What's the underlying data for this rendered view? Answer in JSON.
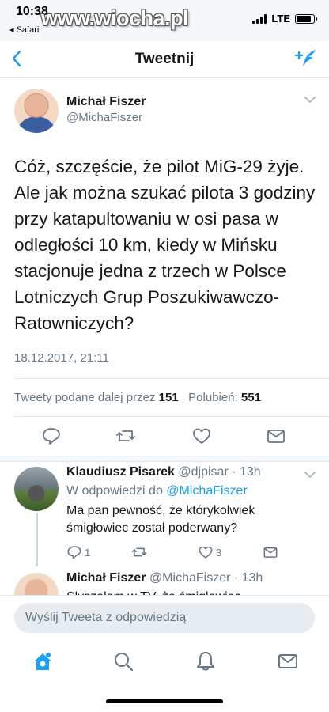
{
  "status_bar": {
    "time": "10:38",
    "back_app": "◂ Safari",
    "network": "LTE",
    "battery_level": 0.85,
    "watermark": "www.wiocha.pl"
  },
  "header": {
    "title": "Tweetnij",
    "back_icon": "chevron-left-icon",
    "compose_icon": "compose-tweet-icon"
  },
  "main_tweet": {
    "author_name": "Michał Fiszer",
    "author_handle": "@MichaFiszer",
    "text": "Cóż, szczęście, że pilot MiG-29 żyje. Ale jak można szukać pilota 3 godziny przy katapultowaniu w osi pasa w odległości 10 km, kiedy w Mińsku stacjonuje jedna z trzech w Polsce Lotniczych Grup Poszukiwawczo-Ratowniczych?",
    "timestamp": "18.12.2017, 21:11",
    "retweets_label": "Tweety podane dalej przez",
    "retweets_count": "151",
    "likes_label": "Polubień:",
    "likes_count": "551"
  },
  "replies": [
    {
      "author_name": "Klaudiusz Pisarek",
      "author_handle": "@djpisar · 13h",
      "reply_to_label": "W odpowiedzi do",
      "reply_to_handle": "@MichaFiszer",
      "text": "Ma pan pewność, że którykolwiek śmigłowiec został poderwany?",
      "reply_count": "1",
      "like_count": "3"
    },
    {
      "author_name": "Michał Fiszer",
      "author_handle": "@MichaFiszer · 13h",
      "text": "Słyszałem w TV, że śmigłowiec"
    }
  ],
  "reply_box": {
    "placeholder": "Wyślij Tweeta z odpowiedzią"
  },
  "tabbar": {
    "items": [
      "home-icon",
      "search-icon",
      "notifications-icon",
      "messages-icon"
    ],
    "active": "home-icon"
  },
  "colors": {
    "accent": "#1da1f2",
    "text": "#14171a",
    "secondary": "#657786",
    "border": "#e1e8ed"
  }
}
